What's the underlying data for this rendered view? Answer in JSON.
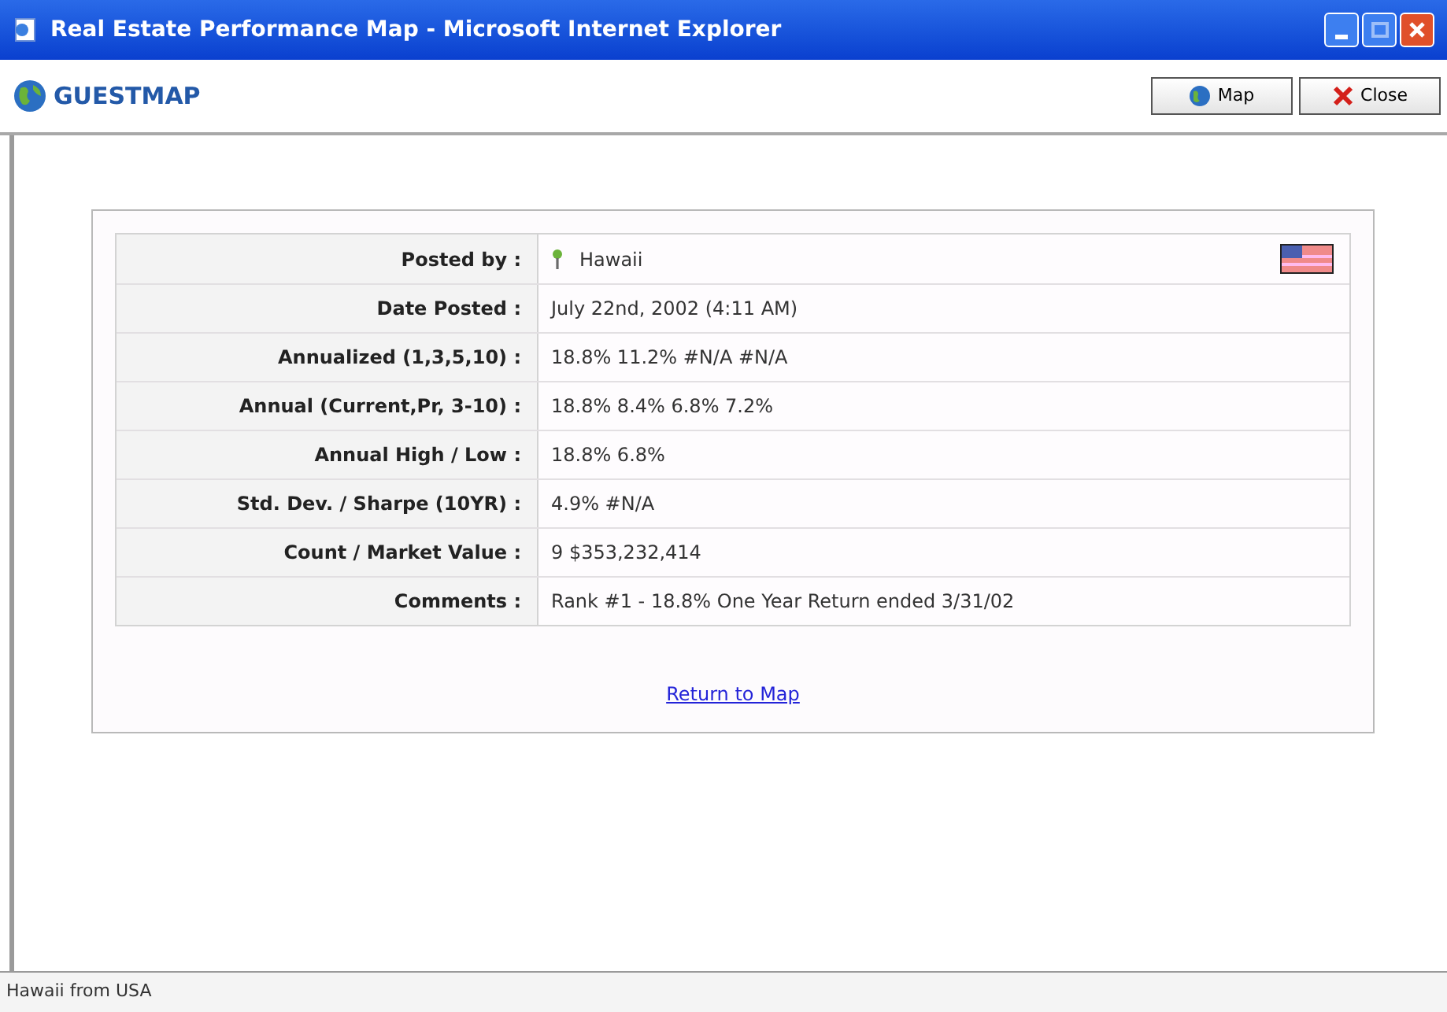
{
  "window": {
    "title": "Real Estate Performance Map - Microsoft Internet Explorer"
  },
  "toolbar": {
    "logo": "GUESTMAP",
    "buttons": [
      {
        "kind": "map",
        "label": "Map"
      },
      {
        "kind": "close",
        "label": "Close"
      }
    ]
  },
  "details": [
    {
      "label": "Posted by :",
      "value": "Hawaii",
      "kind": "poster"
    },
    {
      "label": "Date Posted :",
      "value": "July 22nd, 2002 (4:11 AM)"
    },
    {
      "label": "Annualized (1,3,5,10) :",
      "value": "18.8% 11.2% #N/A #N/A"
    },
    {
      "label": "Annual (Current,Pr, 3-10) :",
      "value": "18.8% 8.4% 6.8% 7.2%"
    },
    {
      "label": "Annual High / Low :",
      "value": "18.8% 6.8%"
    },
    {
      "label": "Std. Dev. / Sharpe (10YR) :",
      "value": "4.9% #N/A"
    },
    {
      "label": "Count / Market Value :",
      "value": "9 $353,232,414"
    },
    {
      "label": "Comments :",
      "value": "Rank #1 - 18.8% One Year Return ended 3/31/02"
    }
  ],
  "link": "Return to Map",
  "status_bar": "Hawaii from USA"
}
